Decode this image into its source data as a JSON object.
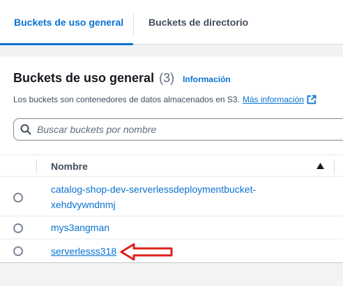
{
  "tabs": {
    "general": "Buckets de uso general",
    "directory": "Buckets de directorio"
  },
  "panel": {
    "title": "Buckets de uso general",
    "count": "(3)",
    "info_link": "Información",
    "description": "Los buckets son contenedores de datos almacenados en S3.",
    "more_info_link": "Más información"
  },
  "search": {
    "placeholder": "Buscar buckets por nombre",
    "value": ""
  },
  "table": {
    "columns": [
      "Nombre"
    ],
    "sort": "ascending",
    "rows": [
      {
        "name": "catalog-shop-dev-serverlessdeploymentbucket-xehdvywndnmj",
        "selected": false
      },
      {
        "name": "mys3angman",
        "selected": false
      },
      {
        "name": "serverlesss318",
        "selected": false,
        "hover": true
      }
    ]
  },
  "annotation": {
    "type": "red-arrow-pointing-left",
    "color": "#e0201b"
  },
  "colors": {
    "accent": "#0972d3",
    "background": "#f2f3f3",
    "text": "#16191f",
    "annotation": "#e0201b"
  }
}
